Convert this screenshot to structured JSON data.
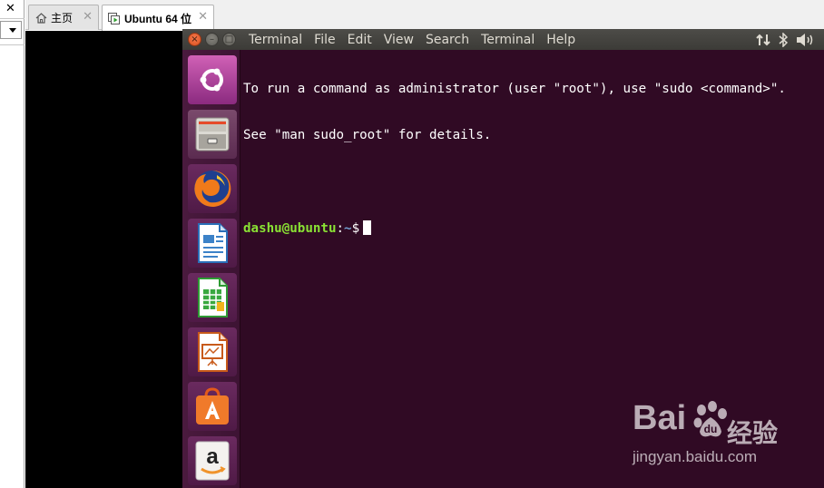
{
  "host": {
    "left_panel": {
      "close_symbol": "✕"
    },
    "tabs": [
      {
        "label": "主页",
        "icon": "home-icon",
        "active": false,
        "close": "✕"
      },
      {
        "label": "Ubuntu 64 位",
        "icon": "vm-play-icon",
        "active": true,
        "close": "✕"
      }
    ]
  },
  "ubuntu": {
    "window_buttons": {
      "close": "×",
      "minimize": "–",
      "maximize": "□"
    },
    "menu": [
      "Terminal",
      "File",
      "Edit",
      "View",
      "Search",
      "Terminal",
      "Help"
    ],
    "indicators": [
      {
        "icon": "network-transfer-icon",
        "glyph": "⇅"
      },
      {
        "icon": "bluetooth-icon",
        "glyph": "ᛒ"
      },
      {
        "icon": "volume-icon",
        "glyph": "🔊"
      }
    ],
    "launcher": [
      {
        "icon": "ubuntu-dash-icon",
        "name": "Search your computer"
      },
      {
        "icon": "files-icon",
        "name": "Files"
      },
      {
        "icon": "firefox-icon",
        "name": "Firefox"
      },
      {
        "icon": "libreoffice-writer-icon",
        "name": "Writer"
      },
      {
        "icon": "libreoffice-calc-icon",
        "name": "Calc"
      },
      {
        "icon": "libreoffice-impress-icon",
        "name": "Impress"
      },
      {
        "icon": "software-center-icon",
        "name": "Software"
      },
      {
        "icon": "amazon-icon",
        "name": "Amazon"
      }
    ],
    "terminal": {
      "line1": "To run a command as administrator (user \"root\"), use \"sudo <command>\".",
      "line2": "See \"man sudo_root\" for details.",
      "prompt_user": "dashu@ubuntu",
      "prompt_sep": ":",
      "prompt_path": "~",
      "prompt_symbol": "$"
    },
    "colors": {
      "terminal_bg": "#300a24",
      "prompt_user": "#8ae234",
      "prompt_path": "#729fcf",
      "panel": "#3c3b37"
    }
  },
  "watermark": {
    "brand": "Bai",
    "brand_suffix": "经验",
    "url": "jingyan.baidu.com"
  }
}
